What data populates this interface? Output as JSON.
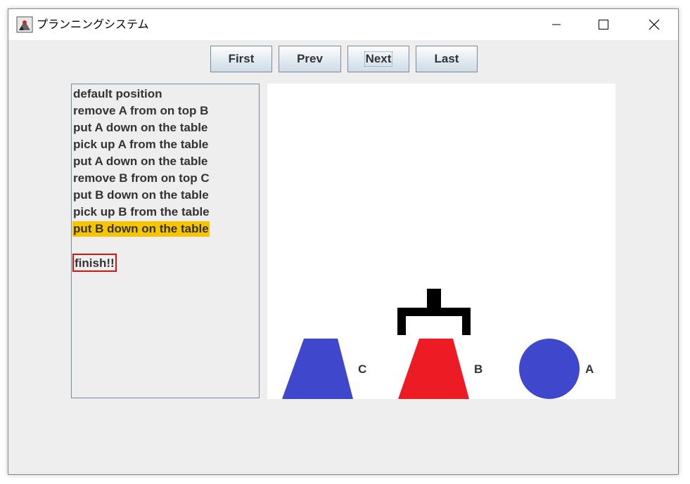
{
  "window": {
    "title": "プランニングシステム"
  },
  "toolbar": {
    "first_label": "First",
    "prev_label": "Prev",
    "next_label": "Next",
    "last_label": "Last"
  },
  "steps": {
    "items": [
      "default position",
      "remove A from on top B",
      "put A down on the table",
      "pick up A from the table",
      "put A down on the table",
      "remove B from on top C",
      "put B down on the table",
      "pick up B from the table",
      "put B down on the table"
    ],
    "selected_index": 8,
    "finish_label": "finish!!"
  },
  "scene": {
    "blocks": [
      {
        "label": "C",
        "shape": "trapezoid",
        "color": "#3f48cc"
      },
      {
        "label": "B",
        "shape": "trapezoid",
        "color": "#ed1c24"
      },
      {
        "label": "A",
        "shape": "circle",
        "color": "#3f48cc"
      }
    ],
    "gripper_color": "#000000"
  },
  "colors": {
    "highlight": "#f7c400",
    "finish_border": "#e01010"
  }
}
